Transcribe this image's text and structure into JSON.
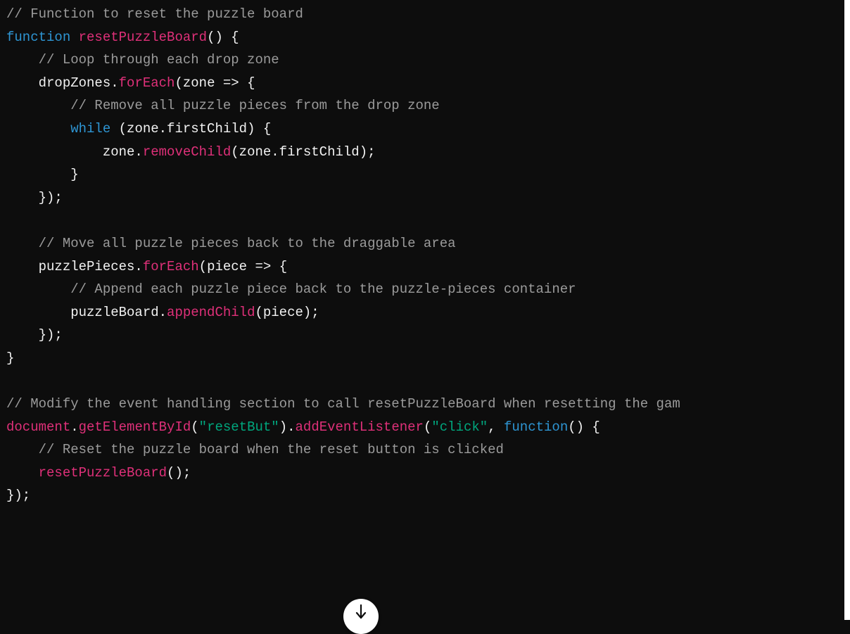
{
  "code_block": {
    "language": "javascript",
    "lines": [
      [
        {
          "t": "// Function to reset the puzzle board",
          "k": "comment"
        }
      ],
      [
        {
          "t": "function",
          "k": "keyword"
        },
        {
          "t": " ",
          "k": "plain"
        },
        {
          "t": "resetPuzzleBoard",
          "k": "fn"
        },
        {
          "t": "() {",
          "k": "plain"
        }
      ],
      [
        {
          "t": "    ",
          "k": "plain"
        },
        {
          "t": "// Loop through each drop zone",
          "k": "comment"
        }
      ],
      [
        {
          "t": "    dropZones.",
          "k": "plain"
        },
        {
          "t": "forEach",
          "k": "fn"
        },
        {
          "t": "(zone => {",
          "k": "plain"
        }
      ],
      [
        {
          "t": "        ",
          "k": "plain"
        },
        {
          "t": "// Remove all puzzle pieces from the drop zone",
          "k": "comment"
        }
      ],
      [
        {
          "t": "        ",
          "k": "plain"
        },
        {
          "t": "while",
          "k": "keyword"
        },
        {
          "t": " (zone.firstChild) {",
          "k": "plain"
        }
      ],
      [
        {
          "t": "            zone.",
          "k": "plain"
        },
        {
          "t": "removeChild",
          "k": "fn"
        },
        {
          "t": "(zone.firstChild);",
          "k": "plain"
        }
      ],
      [
        {
          "t": "        }",
          "k": "plain"
        }
      ],
      [
        {
          "t": "    });",
          "k": "plain"
        }
      ],
      [
        {
          "t": "",
          "k": "plain"
        }
      ],
      [
        {
          "t": "    ",
          "k": "plain"
        },
        {
          "t": "// Move all puzzle pieces back to the draggable area",
          "k": "comment"
        }
      ],
      [
        {
          "t": "    puzzlePieces.",
          "k": "plain"
        },
        {
          "t": "forEach",
          "k": "fn"
        },
        {
          "t": "(piece => {",
          "k": "plain"
        }
      ],
      [
        {
          "t": "        ",
          "k": "plain"
        },
        {
          "t": "// Append each puzzle piece back to the puzzle-pieces container",
          "k": "comment"
        }
      ],
      [
        {
          "t": "        puzzleBoard.",
          "k": "plain"
        },
        {
          "t": "appendChild",
          "k": "fn"
        },
        {
          "t": "(piece);",
          "k": "plain"
        }
      ],
      [
        {
          "t": "    });",
          "k": "plain"
        }
      ],
      [
        {
          "t": "}",
          "k": "plain"
        }
      ],
      [
        {
          "t": "",
          "k": "plain"
        }
      ],
      [
        {
          "t": "// Modify the event handling section to call resetPuzzleBoard when resetting the gam",
          "k": "comment"
        }
      ],
      [
        {
          "t": "document",
          "k": "fn"
        },
        {
          "t": ".",
          "k": "plain"
        },
        {
          "t": "getElementById",
          "k": "fn"
        },
        {
          "t": "(",
          "k": "plain"
        },
        {
          "t": "\"resetBut\"",
          "k": "string"
        },
        {
          "t": ").",
          "k": "plain"
        },
        {
          "t": "addEventListener",
          "k": "fn"
        },
        {
          "t": "(",
          "k": "plain"
        },
        {
          "t": "\"click\"",
          "k": "string"
        },
        {
          "t": ", ",
          "k": "plain"
        },
        {
          "t": "function",
          "k": "keyword"
        },
        {
          "t": "() {",
          "k": "plain"
        }
      ],
      [
        {
          "t": "    ",
          "k": "plain"
        },
        {
          "t": "// Reset the puzzle board when the reset button is clicked",
          "k": "comment"
        }
      ],
      [
        {
          "t": "    ",
          "k": "plain"
        },
        {
          "t": "resetPuzzleBoard",
          "k": "fn"
        },
        {
          "t": "();",
          "k": "plain"
        }
      ],
      [
        {
          "t": "});",
          "k": "plain"
        }
      ]
    ]
  },
  "colors": {
    "background": "#0d0d0d",
    "comment": "#9b9b9b",
    "keyword": "#2e95d3",
    "function": "#df3079",
    "string": "#00a67d",
    "plain": "#f2f2f2"
  },
  "scroll_button": {
    "icon": "arrow-down-icon"
  }
}
